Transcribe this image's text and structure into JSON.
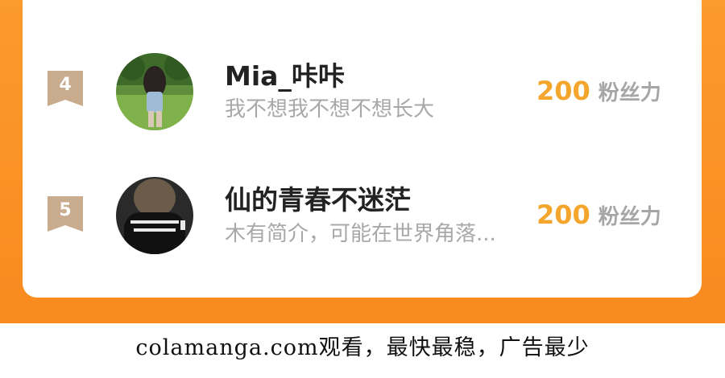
{
  "ranking": [
    {
      "rank": "4",
      "name": "Mia_咔咔",
      "bio": "我不想我不想不想长大",
      "fans_count": "200",
      "fans_unit": "粉丝力",
      "avatar_icon": "girl-in-park-avatar"
    },
    {
      "rank": "5",
      "name": "仙的青春不迷茫",
      "bio": "木有简介，可能在世界角落...",
      "fans_count": "200",
      "fans_unit": "粉丝力",
      "avatar_icon": "dark-hoodie-avatar"
    }
  ],
  "colors": {
    "frame_orange": "#f98a1e",
    "fans_count": "#f4a52b",
    "rank_badge": "#c9ab8e",
    "name": "#222222",
    "bio": "#a8a8a8"
  },
  "footer": {
    "watermark": "colamanga.com观看，最快最稳，广告最少"
  }
}
